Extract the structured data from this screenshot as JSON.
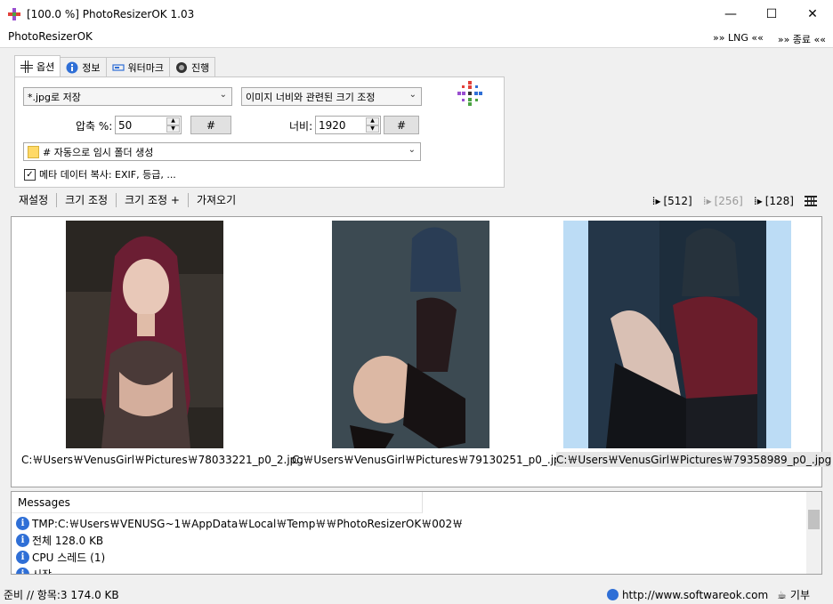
{
  "window": {
    "title": "[100.0 %] PhotoResizerOK 1.03",
    "minimize": "—",
    "maximize": "☐",
    "close": "✕"
  },
  "menu": {
    "app_name": "PhotoResizerOK",
    "lng": "»» LNG ««",
    "exit": "»» 종료 ««"
  },
  "tabs": [
    {
      "label": "옵션",
      "icon": "options-icon"
    },
    {
      "label": "정보",
      "icon": "info-icon"
    },
    {
      "label": "워터마크",
      "icon": "watermark-icon"
    },
    {
      "label": "진행",
      "icon": "progress-icon"
    }
  ],
  "options": {
    "save_format": "*.jpg로 저장",
    "resize_mode": "이미지 너비와 관련된 크기 조정",
    "compression_label": "압축 %:",
    "compression_value": "50",
    "hash_button": "#",
    "width_label": "너비:",
    "width_value": "1920",
    "width_hash_button": "#",
    "folder": "# 자동으로 임시 폴더 생성",
    "meta_copy_label": "메타 데이터 복사: EXIF, 등급, ...",
    "meta_copy_checked": true
  },
  "actions": {
    "reset": "재설정",
    "resize": "크기 조정",
    "resize_plus": "크기 조정 +",
    "import": "가져오기"
  },
  "thumb_sizes": {
    "s512": "[512]",
    "s256": "[256]",
    "s128": "[128]"
  },
  "images": [
    {
      "path": "C:￦Users￦VenusGirl￦Pictures￦78033221_p0_2.jpg",
      "selected": false
    },
    {
      "path": "C:￦Users￦VenusGirl￦Pictures￦79130251_p0_.jpg",
      "selected": false
    },
    {
      "path": "C:￦Users￦VenusGirl￦Pictures￦79358989_p0_.jpg",
      "selected": true
    }
  ],
  "messages": {
    "header": "Messages",
    "items": [
      "TMP:C:￦Users￦VENUSG~1￦AppData￦Local￦Temp￦￦PhotoResizerOK￦002￦",
      "전체 128.0 KB",
      "CPU 스레드 (1)",
      "시작"
    ]
  },
  "status": {
    "left": "준비 // 항목:3 174.0 KB",
    "url": "http://www.softwareok.com",
    "donate": "기부"
  },
  "colors": {
    "selection": "#bcdcf5",
    "accent": "#2f6fd6"
  }
}
